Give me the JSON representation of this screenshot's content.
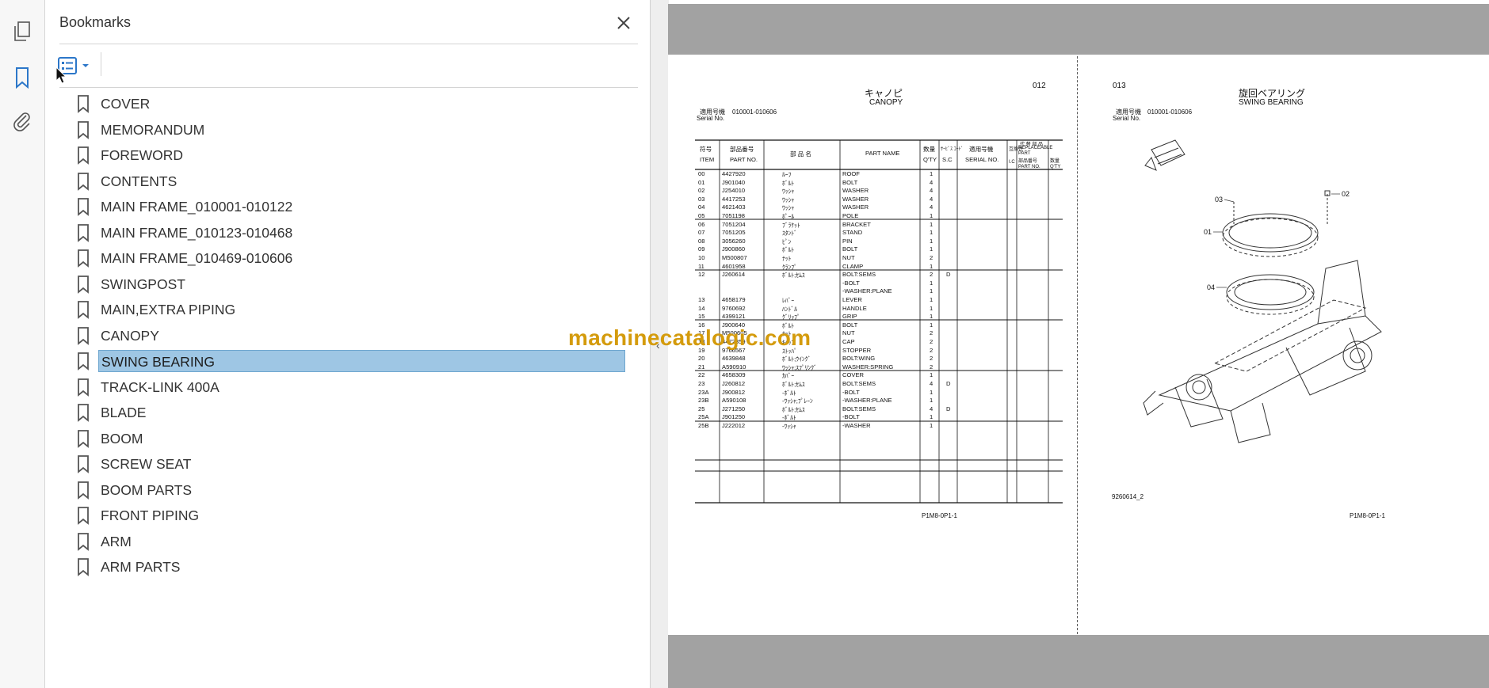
{
  "rail": {
    "icons": [
      "pages-icon",
      "bookmark-icon",
      "attachment-icon"
    ],
    "accent": "#2c77c9"
  },
  "panel": {
    "title": "Bookmarks",
    "close_label": "✕",
    "options_icon": "list-options-icon",
    "bookmarks": [
      {
        "label": "COVER"
      },
      {
        "label": "MEMORANDUM"
      },
      {
        "label": "FOREWORD"
      },
      {
        "label": "CONTENTS"
      },
      {
        "label": "MAIN FRAME_010001-010122"
      },
      {
        "label": "MAIN FRAME_010123-010468"
      },
      {
        "label": "MAIN FRAME_010469-010606"
      },
      {
        "label": "SWINGPOST"
      },
      {
        "label": "MAIN,EXTRA PIPING"
      },
      {
        "label": "CANOPY"
      },
      {
        "label": "SWING BEARING",
        "selected": true
      },
      {
        "label": "TRACK-LINK 400A"
      },
      {
        "label": "BLADE"
      },
      {
        "label": "BOOM"
      },
      {
        "label": "SCREW SEAT"
      },
      {
        "label": "BOOM PARTS"
      },
      {
        "label": "FRONT PIPING"
      },
      {
        "label": "ARM"
      },
      {
        "label": "ARM PARTS"
      }
    ],
    "selection_color": "#9ec6e4"
  },
  "document": {
    "left_page": {
      "page_no": "012",
      "title_jp": "キャノピ",
      "title_en": "CANOPY",
      "serial_label_jp": "適用号機",
      "serial_label_en": "Serial No.",
      "serial_range": "010001-010606",
      "headers": {
        "item_jp": "符号",
        "item_en": "ITEM",
        "partno_jp": "部品番号",
        "partno_en": "PART NO.",
        "name_jp": "部 品 名",
        "name_en": "PART NAME",
        "qty_jp": "数量",
        "qty_en": "Q'TY",
        "sc_jp": "ｻｰﾋﾞｽ ｺｰﾄﾞ",
        "sc_en": "S.C",
        "serial_jp": "適用号機",
        "serial_en": "SERIAL NO.",
        "compat_jp": "互換性",
        "compat_en": "I.C",
        "repl_jp": "代 替 部 品",
        "repl_en": "REPLACEABLE PART",
        "repl_partno": "部品番号 PART NO.",
        "repl_qty": "数量 Q'TY"
      },
      "rows": [
        [
          "00",
          "4427920",
          "ﾙｰﾌ",
          "ROOF",
          "1",
          ""
        ],
        [
          "01",
          "J901040",
          "ﾎﾞﾙﾄ",
          "BOLT",
          "4",
          ""
        ],
        [
          "02",
          "J254010",
          "ﾜｯｼｬ",
          "WASHER",
          "4",
          ""
        ],
        [
          "03",
          "4417253",
          "ﾜｯｼｬ",
          "WASHER",
          "4",
          ""
        ],
        [
          "04",
          "4621403",
          "ﾜｯｼｬ",
          "WASHER",
          "4",
          ""
        ],
        [
          "05",
          "7051198",
          "ﾎﾟｰﾙ",
          "POLE",
          "1",
          ""
        ],
        [
          "06",
          "7051204",
          "ﾌﾞﾗｹｯﾄ",
          "BRACKET",
          "1",
          ""
        ],
        [
          "07",
          "7051205",
          "ｽﾀﾝﾄﾞ",
          "STAND",
          "1",
          ""
        ],
        [
          "08",
          "3056260",
          "ﾋﾟﾝ",
          "PIN",
          "1",
          ""
        ],
        [
          "09",
          "J900860",
          "ﾎﾞﾙﾄ",
          "BOLT",
          "1",
          ""
        ],
        [
          "10",
          "M500807",
          "ﾅｯﾄ",
          "NUT",
          "2",
          ""
        ],
        [
          "11",
          "4601958",
          "ｸﾗﾝﾌﾟ",
          "CLAMP",
          "1",
          ""
        ],
        [
          "12",
          "J260614",
          "ﾎﾞﾙﾄ;ｾﾑｽ",
          "BOLT:SEMS",
          "2",
          "D"
        ],
        [
          "",
          "",
          "",
          "-BOLT",
          "1",
          ""
        ],
        [
          "",
          "",
          "",
          "-WASHER:PLANE",
          "1",
          ""
        ],
        [
          "13",
          "4658179",
          "ﾚﾊﾞｰ",
          "LEVER",
          "1",
          ""
        ],
        [
          "14",
          "9760692",
          "ﾊﾝﾄﾞﾙ",
          "HANDLE",
          "1",
          ""
        ],
        [
          "15",
          "4399121",
          "ｸﾞﾘｯﾌﾟ",
          "GRIP",
          "1",
          ""
        ],
        [
          "16",
          "J900640",
          "ﾎﾞﾙﾄ",
          "BOLT",
          "1",
          ""
        ],
        [
          "17",
          "M500605",
          "ﾅｯﾄ",
          "NUT",
          "2",
          ""
        ],
        [
          "18",
          "4472359",
          "ｷｬｯﾌﾟ",
          "CAP",
          "2",
          ""
        ],
        [
          "19",
          "9766567",
          "ｽﾄｯﾊﾟ",
          "STOPPER",
          "2",
          ""
        ],
        [
          "20",
          "4639848",
          "ﾎﾞﾙﾄ;ｳｲﾝｸﾞ",
          "BOLT:WING",
          "2",
          ""
        ],
        [
          "21",
          "A590910",
          "ﾜｯｼｬ;ｽﾌﾟﾘﾝｸﾞ",
          "WASHER:SPRING",
          "2",
          ""
        ],
        [
          "22",
          "4658309",
          "ｶﾊﾞｰ",
          "COVER",
          "1",
          ""
        ],
        [
          "23",
          "J260812",
          "ﾎﾞﾙﾄ;ｾﾑｽ",
          "BOLT:SEMS",
          "4",
          "D"
        ],
        [
          "23A",
          "J900812",
          "-ﾎﾞﾙﾄ",
          "-BOLT",
          "1",
          ""
        ],
        [
          "23B",
          "A590108",
          "-ﾜｯｼｬ;ﾌﾟﾚｰﾝ",
          "-WASHER:PLANE",
          "1",
          ""
        ],
        [
          "25",
          "J271250",
          "ﾎﾞﾙﾄ;ｾﾑｽ",
          "BOLT:SEMS",
          "4",
          "D"
        ],
        [
          "25A",
          "J901250",
          "-ﾎﾞﾙﾄ",
          "-BOLT",
          "1",
          ""
        ],
        [
          "25B",
          "J222012",
          "-ﾜｯｼｬ",
          "-WASHER",
          "1",
          ""
        ]
      ],
      "footer_code": "P1M8-0P1-1"
    },
    "right_page": {
      "page_no": "013",
      "title_jp": "旋回ベアリング",
      "title_en": "SWING BEARING",
      "serial_label_jp": "適用号機",
      "serial_label_en": "Serial No.",
      "serial_range": "010001-010606",
      "callouts": [
        "01",
        "02",
        "03",
        "04"
      ],
      "drawing_no": "9260614_2",
      "footer_code": "P1M8-0P1-1"
    },
    "watermark": "machinecatalogic.com",
    "watermark_color": "#d49b0c"
  }
}
